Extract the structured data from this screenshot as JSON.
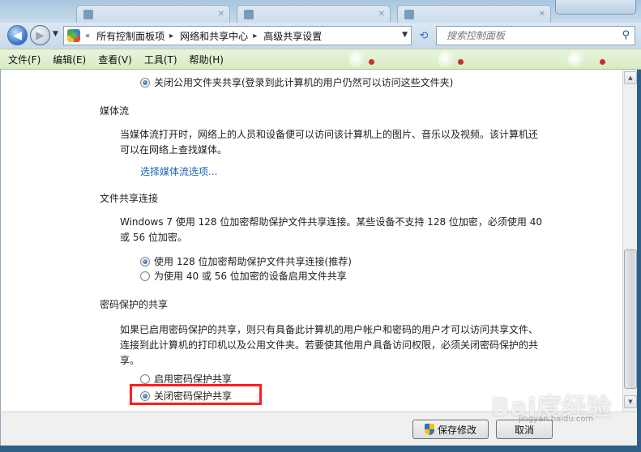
{
  "nav": {
    "breadcrumbs": [
      "所有控制面板项",
      "网络和共享中心",
      "高级共享设置"
    ],
    "search_placeholder": "搜索控制面板"
  },
  "menu": [
    "文件(F)",
    "编辑(E)",
    "查看(V)",
    "工具(T)",
    "帮助(H)"
  ],
  "public_folder": {
    "option_off": "关闭公用文件夹共享(登录到此计算机的用户仍然可以访问这些文件夹)",
    "option_off_checked": true
  },
  "media": {
    "title": "媒体流",
    "description": "当媒体流打开时，网络上的人员和设备便可以访问该计算机上的图片、音乐以及视频。该计算机还可以在网络上查找媒体。",
    "link": "选择媒体流选项..."
  },
  "file_sharing": {
    "title": "文件共享连接",
    "description": "Windows 7 使用 128 位加密帮助保护文件共享连接。某些设备不支持 128 位加密，必须使用 40 或 56 位加密。",
    "options": [
      {
        "label": "使用 128 位加密帮助保护文件共享连接(推荐)",
        "checked": true
      },
      {
        "label": "为使用 40 或 56 位加密的设备启用文件共享",
        "checked": false
      }
    ]
  },
  "password": {
    "title": "密码保护的共享",
    "description": "如果已启用密码保护的共享，则只有具备此计算机的用户帐户和密码的用户才可以访问共享文件、连接到此计算机的打印机以及公用文件夹。若要使其他用户具备访问权限，必须关闭密码保护的共享。",
    "options": [
      {
        "label": "启用密码保护共享",
        "checked": false
      },
      {
        "label": "关闭密码保护共享",
        "checked": true
      }
    ]
  },
  "footer": {
    "save": "保存修改",
    "cancel": "取消"
  },
  "watermark": "Bai度经验",
  "watermark_sub": "jingyan.baidu.com"
}
